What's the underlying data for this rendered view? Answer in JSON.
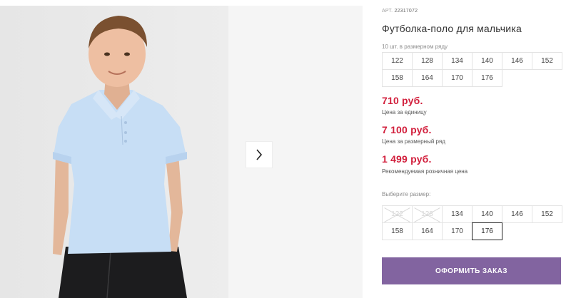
{
  "product": {
    "art_label": "АРТ.",
    "art_value": "22317072",
    "title": "Футболка-поло для мальчика"
  },
  "pack": {
    "note": "10 шт. в размерном ряду",
    "sizes": [
      "122",
      "128",
      "134",
      "140",
      "146",
      "152",
      "158",
      "164",
      "170",
      "176"
    ]
  },
  "prices": [
    {
      "value": "710 руб.",
      "label": "Цена за единицу"
    },
    {
      "value": "7 100 руб.",
      "label": "Цена за размерный ряд"
    },
    {
      "value": "1 499 руб.",
      "label": "Рекомендуемая розничная цена"
    }
  ],
  "size_picker": {
    "label": "Выберите размер:",
    "options": [
      {
        "size": "122",
        "state": "unavailable"
      },
      {
        "size": "128",
        "state": "unavailable"
      },
      {
        "size": "134",
        "state": "available"
      },
      {
        "size": "140",
        "state": "available"
      },
      {
        "size": "146",
        "state": "available"
      },
      {
        "size": "152",
        "state": "available"
      },
      {
        "size": "158",
        "state": "available"
      },
      {
        "size": "164",
        "state": "available"
      },
      {
        "size": "170",
        "state": "available"
      },
      {
        "size": "176",
        "state": "selected"
      }
    ]
  },
  "order_button": "ОФОРМИТЬ ЗАКАЗ",
  "colors": {
    "price": "#d21f3c",
    "order_button_bg": "#8264a0",
    "shirt": "#c7def5",
    "pants": "#1c1c1e"
  },
  "icons": {
    "next": "chevron-right-icon"
  }
}
